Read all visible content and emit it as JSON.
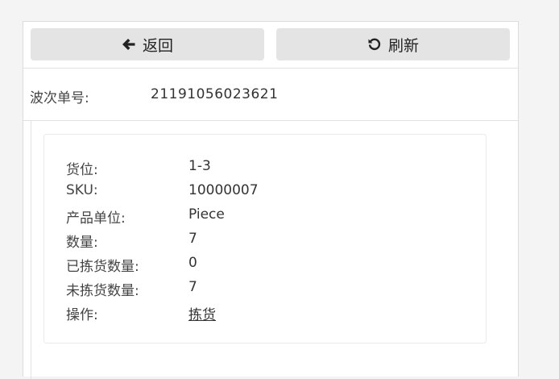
{
  "toolbar": {
    "back_label": "返回",
    "refresh_label": "刷新"
  },
  "wave": {
    "label": "波次单号:",
    "value": "21191056023621"
  },
  "item": {
    "location_label": "货位:",
    "location_value": "1-3",
    "sku_label": "SKU:",
    "sku_value": "10000007",
    "unit_label": "产品单位:",
    "unit_value": "Piece",
    "qty_label": "数量:",
    "qty_value": "7",
    "picked_label": "已拣货数量:",
    "picked_value": "0",
    "unpicked_label": "未拣货数量:",
    "unpicked_value": "7",
    "action_label": "操作:",
    "action_link": "拣货"
  },
  "icons": {
    "back": "arrow-left-icon",
    "refresh": "refresh-icon"
  }
}
